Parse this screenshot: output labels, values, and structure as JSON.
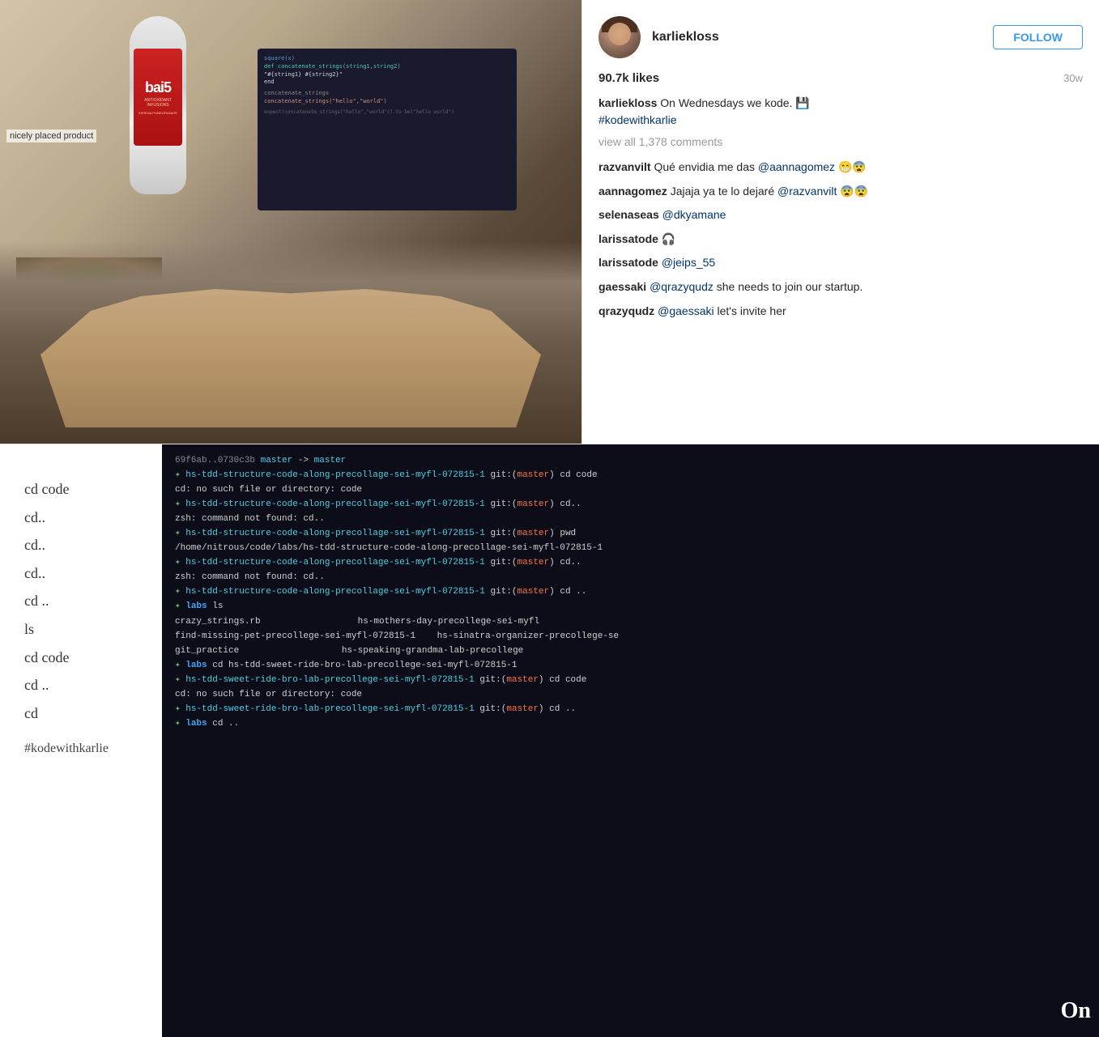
{
  "profile": {
    "username": "karliekloss",
    "avatar_alt": "karliekloss avatar",
    "follow_label": "FOLLOW",
    "likes": "90.7k likes",
    "time_ago": "30w",
    "caption_username": "karliekloss",
    "caption_text": "On Wednesdays we kode. 💾",
    "caption_hashtag": "#kodewithkarlie",
    "view_comments": "view all 1,378 comments"
  },
  "comments": [
    {
      "username": "razvanvilt",
      "text": "Qué envidia me das @aannagomez 😁😨"
    },
    {
      "username": "aannagomez",
      "text": "Jajaja ya te lo dejaré @razvanvilt 😨😨"
    },
    {
      "username": "selenaseas",
      "text": "@dkyamane"
    },
    {
      "username": "larissatode",
      "text": "🎧"
    },
    {
      "username": "larissatode",
      "text": "@jeips_55"
    },
    {
      "username": "gaessaki",
      "text": "@qrazyqudz she needs to join our startup."
    },
    {
      "username": "qrazyqudz",
      "text": "@gaessaki let's invite her"
    }
  ],
  "product_label": "nicely placed product",
  "bottom_left_lines": [
    "cd code",
    "cd..",
    "cd..",
    "cd..",
    "cd ..",
    "ls",
    "cd code",
    "cd ..",
    "cd"
  ],
  "hashtag_bottom": "#kodewithkarlie",
  "terminal_lines": [
    {
      "text": "69f6ab..0730c3b  master -> master",
      "classes": [
        "t-white"
      ]
    },
    {
      "text": "✦ hs-tdd-structure-code-along-precollage-sei-myfl-072815-1 git:(master) cd code",
      "classes": [
        "t-cyan"
      ]
    },
    {
      "text": "cd: no such file or directory: code",
      "classes": [
        "t-white"
      ]
    },
    {
      "text": "✦ hs-tdd-structure-code-along-precollage-sei-myfl-072815-1 git:(master) cd..",
      "classes": [
        "t-cyan"
      ]
    },
    {
      "text": "zsh: command not found: cd..",
      "classes": [
        "t-white"
      ]
    },
    {
      "text": "✦ hs-tdd-structure-code-along-precollage-sei-myfl-072815-1 git:(master) pwd",
      "classes": [
        "t-cyan"
      ]
    },
    {
      "text": "/home/nitrous/code/labs/hs-tdd-structure-code-along-precollage-sei-myfl-072815-1",
      "classes": [
        "t-white"
      ]
    },
    {
      "text": "✦ hs-tdd-structure-code-along-precollage-sei-myfl-072815-1 git:(master) cd..",
      "classes": [
        "t-cyan"
      ]
    },
    {
      "text": "zsh: command not found: cd..",
      "classes": [
        "t-white"
      ]
    },
    {
      "text": "✦ hs-tdd-structure-code-along-precollage-sei-myfl-072815-1 git:(master) cd ..",
      "classes": [
        "t-cyan"
      ]
    },
    {
      "text": "✦ labs ls",
      "classes": [
        "t-cyan"
      ]
    },
    {
      "text": "crazy_strings.rb                    hs-mothers-day-precollege-sei-myfl",
      "classes": [
        "t-white"
      ]
    },
    {
      "text": "find-missing-pet-precollege-sei-myfl-072815-1  hs-sinatra-organizer-precollege-se",
      "classes": [
        "t-white"
      ]
    },
    {
      "text": "git_practice                        hs-speaking-grandma-lab-precollege",
      "classes": [
        "t-white"
      ]
    },
    {
      "text": "✦ labs  cd hs-tdd-sweet-ride-bro-lab-precollege-sei-myfl-072815-1",
      "classes": [
        "t-cyan"
      ]
    },
    {
      "text": "✦ hs-tdd-sweet-ride-bro-lab-precollege-sei-myfl-072815-1 git:(master) cd code",
      "classes": [
        "t-cyan"
      ]
    },
    {
      "text": "cd: no such file or directory: code",
      "classes": [
        "t-white"
      ]
    },
    {
      "text": "✦ hs-tdd-sweet-ride-bro-lab-precollege-sei-myfl-072815-1 git:(master) cd ..",
      "classes": [
        "t-cyan"
      ]
    },
    {
      "text": "✦ labs  cd ..",
      "classes": [
        "t-cyan"
      ]
    }
  ],
  "on_text": "On"
}
